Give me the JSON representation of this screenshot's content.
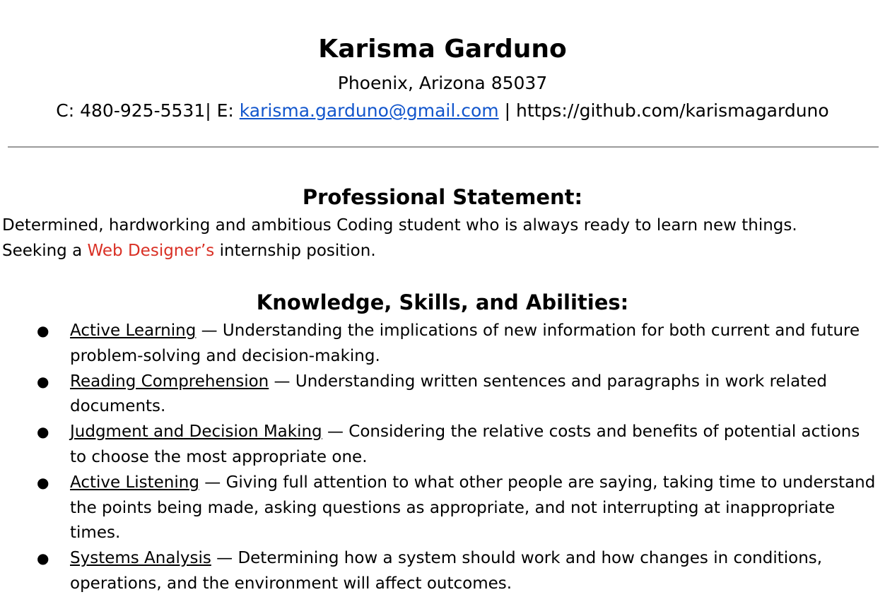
{
  "header": {
    "name": "Karisma Garduno",
    "location": "Phoenix, Arizona 85037",
    "phone_label": "C: 480-925-5531| E: ",
    "email": "karisma.garduno@gmail.com",
    "separator": " |  ",
    "github": "https://github.com/karismagarduno"
  },
  "statement": {
    "title": "Professional Statement:",
    "line1": "Determined, hardworking and ambitious Coding student who is always ready to learn new things.",
    "line2_prefix": "Seeking a ",
    "line2_highlight": "Web Designer’s",
    "line2_suffix": " internship position."
  },
  "skills": {
    "title": "Knowledge, Skills, and Abilities:",
    "bullet": "●",
    "items": [
      {
        "name": "Active Learning",
        "description": " — Understanding the implications of new information for both current and future problem-solving and decision-making."
      },
      {
        "name": "Reading Comprehension",
        "description": " — Understanding written sentences and paragraphs in work related documents."
      },
      {
        "name": "Judgment and Decision Making",
        "description": " — Considering the relative costs and benefits of potential actions to choose the most appropriate one."
      },
      {
        "name": "Active Listening",
        "description": " — Giving full attention to what other people are saying, taking time to understand the points being made, asking questions as appropriate, and not interrupting at inappropriate times."
      },
      {
        "name": "Systems Analysis",
        "description": " — Determining how a system should work and how changes in conditions, operations, and the environment will affect outcomes."
      }
    ]
  },
  "colors": {
    "link": "#1155cc",
    "highlight": "#d93025",
    "rule": "#9a9a9a"
  }
}
